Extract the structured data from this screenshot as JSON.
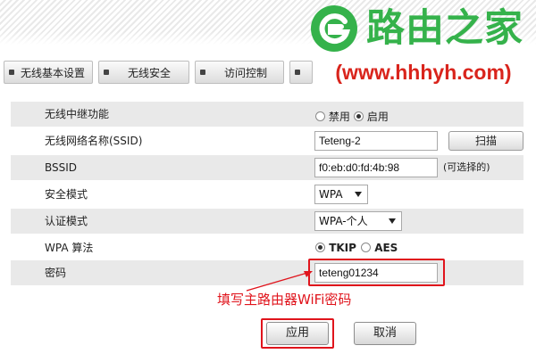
{
  "watermark": {
    "brand_name": "路由之家",
    "url": "(www.hhhyh.com)",
    "brand_color": "#35b24b",
    "url_color": "#d9241c"
  },
  "tabs": [
    {
      "label": "无线基本设置"
    },
    {
      "label": "无线安全"
    },
    {
      "label": "访问控制"
    }
  ],
  "form": {
    "repeater": {
      "label": "无线中继功能",
      "options": [
        {
          "label": "禁用",
          "selected": false
        },
        {
          "label": "启用",
          "selected": true
        }
      ]
    },
    "ssid": {
      "label": "无线网络名称(SSID)",
      "value": "Teteng-2",
      "scan_button": "扫描"
    },
    "bssid": {
      "label": "BSSID",
      "value": "f0:eb:d0:fd:4b:98",
      "note": "(可选择的)"
    },
    "security_mode": {
      "label": "安全模式",
      "selected": "WPA"
    },
    "auth_mode": {
      "label": "认证模式",
      "selected": "WPA-个人"
    },
    "wpa_algorithm": {
      "label": "WPA 算法",
      "options": [
        {
          "label": "TKIP",
          "selected": true
        },
        {
          "label": "AES",
          "selected": false
        }
      ]
    },
    "password": {
      "label": "密码",
      "value": "teteng01234"
    }
  },
  "annotation": {
    "text": "填写主路由器WiFi密码",
    "color": "#e0141c"
  },
  "actions": {
    "apply": "应用",
    "cancel": "取消"
  }
}
